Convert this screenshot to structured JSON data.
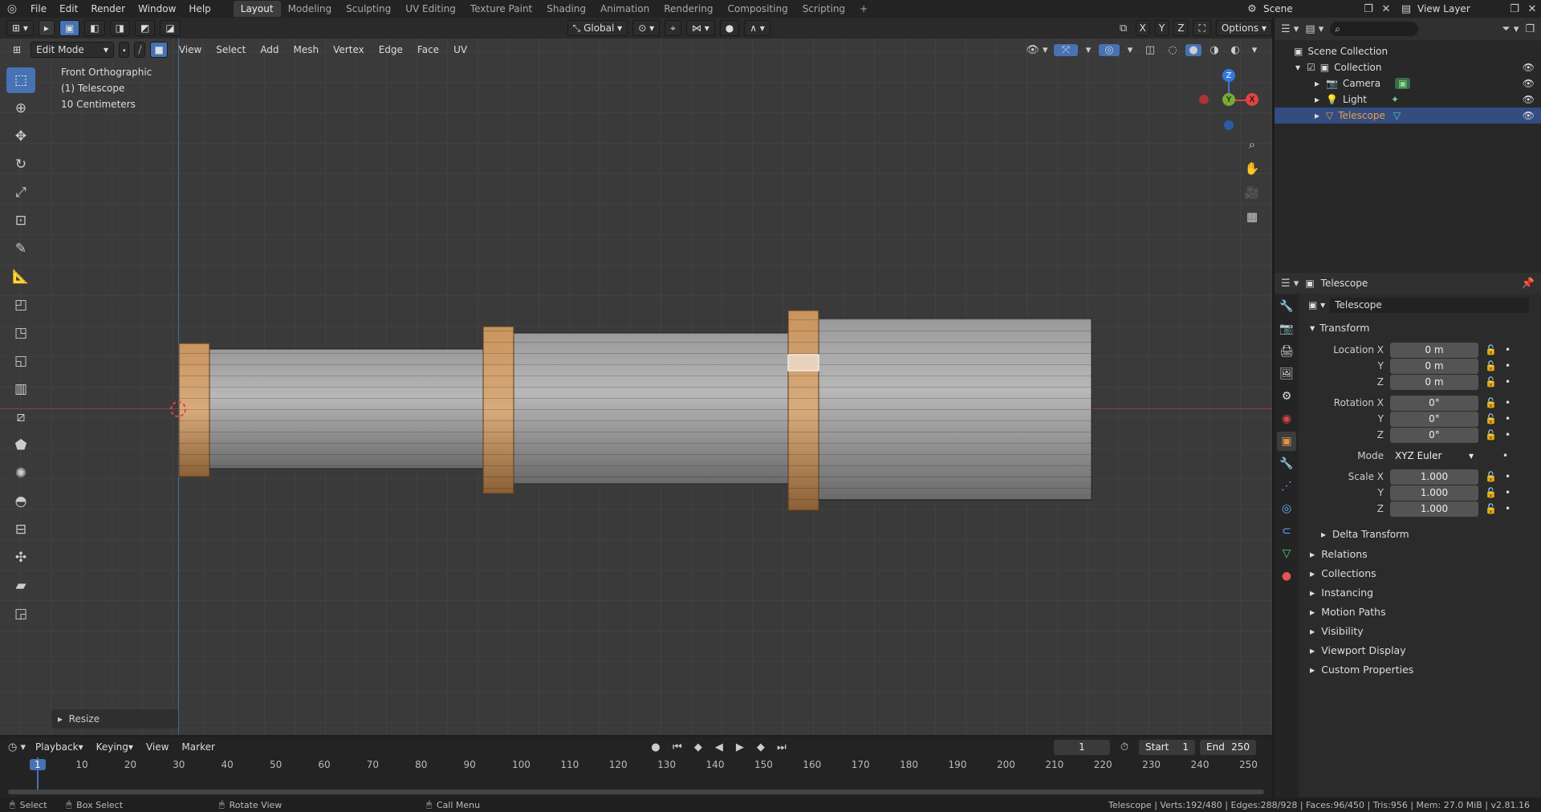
{
  "topbar": {
    "menus": [
      "File",
      "Edit",
      "Render",
      "Window",
      "Help"
    ],
    "workspaces": [
      "Layout",
      "Modeling",
      "Sculpting",
      "UV Editing",
      "Texture Paint",
      "Shading",
      "Animation",
      "Rendering",
      "Compositing",
      "Scripting"
    ],
    "active_workspace": "Layout",
    "add_tab": "+",
    "scene_name": "Scene",
    "view_layer": "View Layer",
    "transform_orientation": "Global",
    "options_label": "Options",
    "axis_x": "X",
    "axis_y": "Y",
    "axis_z": "Z"
  },
  "viewport_header": {
    "mode": "Edit Mode",
    "menus": [
      "View",
      "Select",
      "Add",
      "Mesh",
      "Vertex",
      "Edge",
      "Face",
      "UV"
    ]
  },
  "viewport": {
    "view_name": "Front Orthographic",
    "object_label": "(1) Telescope",
    "scale_label": "10 Centimeters",
    "last_op": "Resize",
    "gizmo": {
      "z": "Z",
      "y": "Y",
      "x": "X"
    }
  },
  "outliner": {
    "root": "Scene Collection",
    "items": [
      {
        "name": "Collection",
        "level": 1
      },
      {
        "name": "Camera",
        "level": 2
      },
      {
        "name": "Light",
        "level": 2
      },
      {
        "name": "Telescope",
        "level": 2,
        "selected": true
      }
    ]
  },
  "properties": {
    "object_name": "Telescope",
    "datablock_name": "Telescope",
    "transform_title": "Transform",
    "location": {
      "label": "Location X",
      "x": "0 m",
      "y": "0 m",
      "z": "0 m"
    },
    "rotation": {
      "label": "Rotation X",
      "x": "0°",
      "y": "0°",
      "z": "0°"
    },
    "mode": {
      "label": "Mode",
      "value": "XYZ Euler"
    },
    "scale": {
      "label": "Scale X",
      "x": "1.000",
      "y": "1.000",
      "z": "1.000"
    },
    "axis_y": "Y",
    "axis_z": "Z",
    "subpanels": [
      "Delta Transform",
      "Relations",
      "Collections",
      "Instancing",
      "Motion Paths",
      "Visibility",
      "Viewport Display",
      "Custom Properties"
    ]
  },
  "timeline": {
    "menus": [
      "Playback",
      "Keying",
      "View",
      "Marker"
    ],
    "current_frame": "1",
    "start_label": "Start",
    "start": "1",
    "end_label": "End",
    "end": "250",
    "ruler": [
      "1",
      "10",
      "20",
      "30",
      "40",
      "50",
      "60",
      "70",
      "80",
      "90",
      "100",
      "110",
      "120",
      "130",
      "140",
      "150",
      "160",
      "170",
      "180",
      "190",
      "200",
      "210",
      "220",
      "230",
      "240",
      "250"
    ]
  },
  "statusbar": {
    "select": "Select",
    "box_select": "Box Select",
    "rotate_view": "Rotate View",
    "call_menu": "Call Menu",
    "stats": "Telescope | Verts:192/480 | Edges:288/928 | Faces:96/450 | Tris:956 | Mem: 27.0 MiB | v2.81.16"
  },
  "colors": {
    "accent": "#4772b3",
    "selected_row": "#334d80",
    "ring": "#c8945e",
    "tube": "#9a9a9a",
    "x_axis": "#d44",
    "y_axis": "#7a3",
    "z_axis": "#37d"
  }
}
